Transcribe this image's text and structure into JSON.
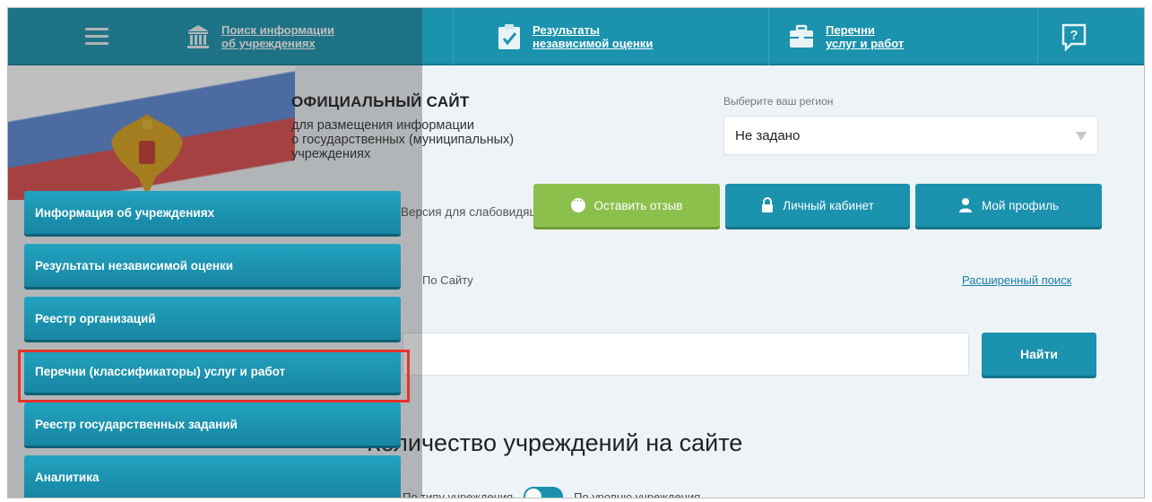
{
  "topnav": {
    "items": [
      {
        "label_line1": "Поиск информации",
        "label_line2": "об учреждениях"
      },
      {
        "label_line1": "Результаты",
        "label_line2": "независимой оценки"
      },
      {
        "label_line1": "Перечни",
        "label_line2": "услуг и работ"
      }
    ]
  },
  "header": {
    "title": "ОФИЦИАЛЬНЫЙ САЙТ",
    "subtitle_lines": [
      "для размещения информации",
      "о государственных (муниципальных)",
      "учреждениях"
    ],
    "region_label": "Выберите ваш регион",
    "region_value": "Не задано"
  },
  "actions": {
    "low_vision": "Версия для слабовидящих",
    "feedback": "Оставить отзыв",
    "cabinet": "Личный кабинет",
    "profile": "Мой профиль"
  },
  "search": {
    "by_label": "По Сайту",
    "advanced": "Расширенный поиск",
    "find_button": "Найти"
  },
  "stats": {
    "title": "Количество учреждений на сайте",
    "toggle_left": "По типу учреждения",
    "toggle_right": "По уровню учреждения"
  },
  "side_menu": {
    "items": [
      {
        "label": "Информация об учреждениях"
      },
      {
        "label": "Результаты независимой оценки"
      },
      {
        "label": "Реестр организаций"
      },
      {
        "label": "Перечни (классификаторы) услуг и работ"
      },
      {
        "label": "Реестр государственных заданий"
      },
      {
        "label": "Аналитика"
      }
    ],
    "highlighted_index": 3
  },
  "colors": {
    "primary": "#1b92ae",
    "green": "#8cc04d",
    "highlight": "#e53327"
  }
}
